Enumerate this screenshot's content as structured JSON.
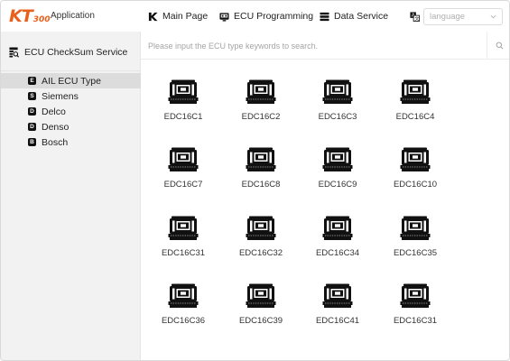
{
  "header": {
    "logo_kt": "KT",
    "logo_num": "300",
    "app_label": "Application",
    "nav": {
      "main_page": "Main Page",
      "ecu_programming": "ECU Programming",
      "data_service": "Data Service"
    },
    "language_placeholder": "language"
  },
  "sidebar": {
    "title": "ECU CheckSum Service",
    "items": [
      {
        "badge": "E",
        "label": "AIL ECU Type",
        "active": true
      },
      {
        "badge": "S",
        "label": "Siemens",
        "active": false
      },
      {
        "badge": "D",
        "label": "Delco",
        "active": false
      },
      {
        "badge": "D",
        "label": "Denso",
        "active": false
      },
      {
        "badge": "B",
        "label": "Bosch",
        "active": false
      }
    ]
  },
  "search": {
    "placeholder": "Please input the ECU type keywords to search."
  },
  "ecus": [
    "EDC16C1",
    "EDC16C2",
    "EDC16C3",
    "EDC16C4",
    "EDC16C7",
    "EDC16C8",
    "EDC16C9",
    "EDC16C10",
    "EDC16C31",
    "EDC16C32",
    "EDC16C34",
    "EDC16C35",
    "EDC16C36",
    "EDC16C39",
    "EDC16C41",
    "EDC16C31"
  ],
  "colors": {
    "brand": "#e8601c",
    "sidebar_bg": "#f2f2f2",
    "sidebar_active": "#dcdcdc"
  }
}
